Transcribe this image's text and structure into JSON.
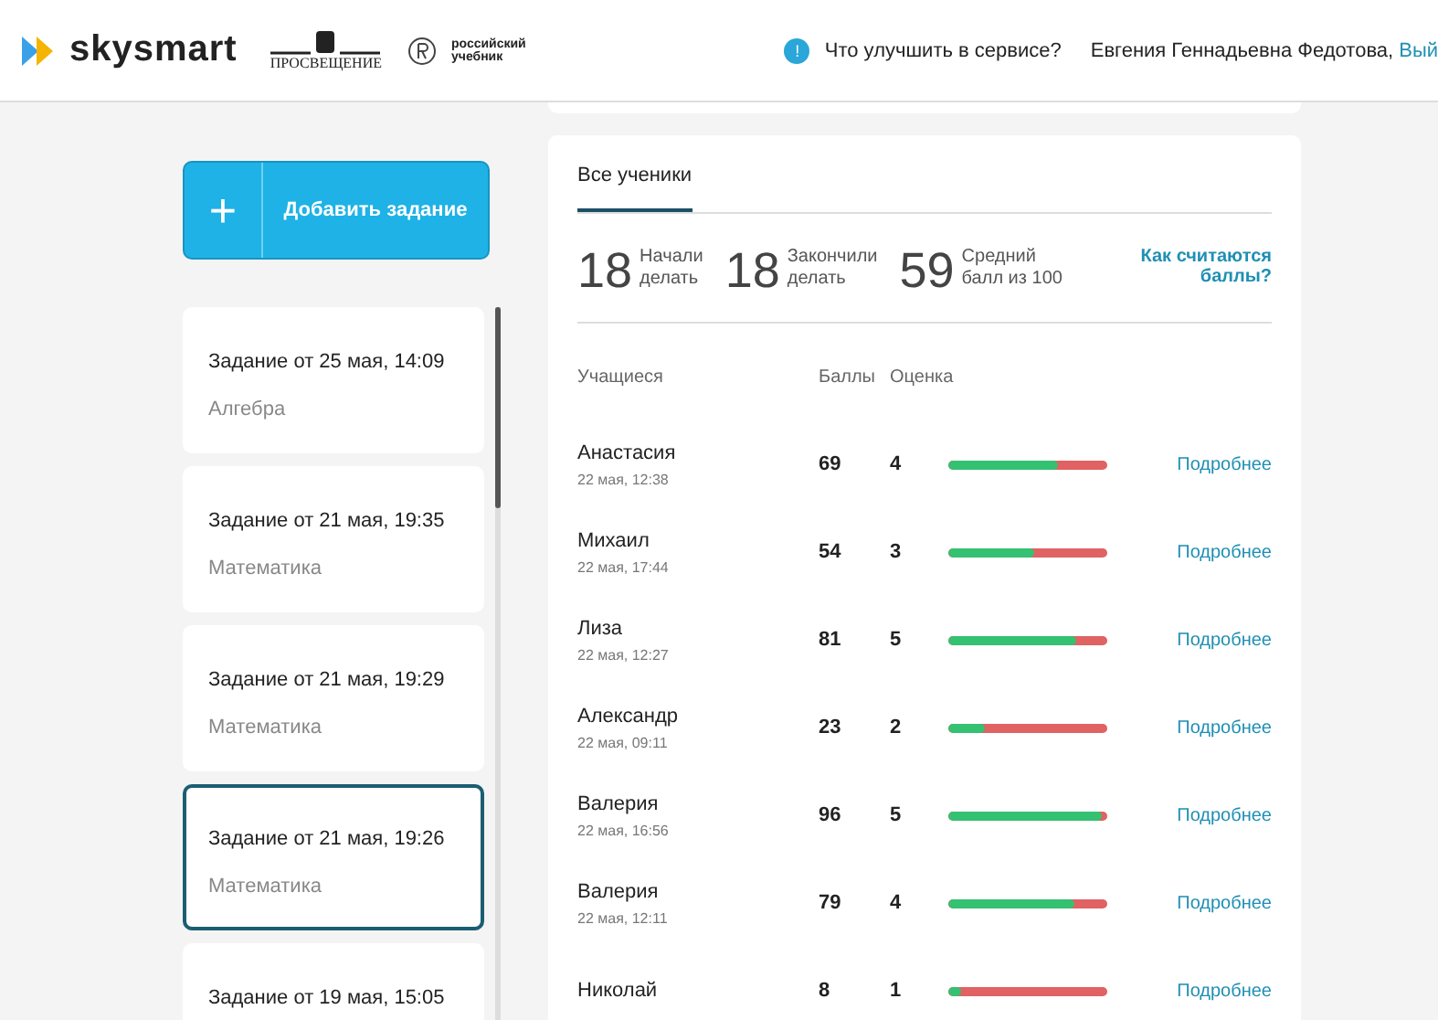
{
  "header": {
    "brand": "skysmart",
    "partner_1": "ПРОСВЕЩЕНИЕ",
    "partner_2": "российский учебник",
    "help_badge": "!",
    "help_link": "Что улучшить в сервисе?",
    "user_name": "Евгения Геннадьевна Федотова,",
    "logout_link": "Вый"
  },
  "sidebar": {
    "add_button": {
      "icon": "+",
      "label": "Добавить задание"
    },
    "assignments": [
      {
        "title": "Задание от 25 мая, 14:09",
        "subject": "Алгебра",
        "selected": false
      },
      {
        "title": "Задание от 21 мая, 19:35",
        "subject": "Математика",
        "selected": false
      },
      {
        "title": "Задание от 21 мая, 19:29",
        "subject": "Математика",
        "selected": false
      },
      {
        "title": "Задание от 21 мая, 19:26",
        "subject": "Математика",
        "selected": true
      },
      {
        "title": "Задание от 19 мая, 15:05",
        "selected": false
      }
    ]
  },
  "main": {
    "tabs": [
      {
        "label": "Все ученики",
        "selected": true
      }
    ],
    "stats": [
      {
        "number": "18",
        "label_1": "Начали",
        "label_2": "делать"
      },
      {
        "number": "18",
        "label_1": "Закончили",
        "label_2": "делать"
      },
      {
        "number": "59",
        "label_1": "Средний",
        "label_2": "балл из 100"
      }
    ],
    "help_link": "Как считаются баллы?",
    "columns": [
      "Учащиеся",
      "Баллы",
      "Оценка"
    ],
    "rows": [
      {
        "name": "Анастасия",
        "time": "22 мая, 12:38",
        "score": "69",
        "grade": "4",
        "level": 0.69,
        "link": "Подробнее"
      },
      {
        "name": "Михаил",
        "time": "22 мая, 17:44",
        "score": "54",
        "grade": "3",
        "level": 0.54,
        "link": "Подробнее"
      },
      {
        "name": "Лиза",
        "time": "22 мая, 12:27",
        "score": "81",
        "grade": "5",
        "level": 0.81,
        "link": "Подробнее"
      },
      {
        "name": "Александр",
        "time": "22 мая, 09:11",
        "score": "23",
        "grade": "2",
        "level": 0.23,
        "link": "Подробнее"
      },
      {
        "name": "Валерия",
        "time": "22 мая, 16:56",
        "score": "96",
        "grade": "5",
        "level": 0.96,
        "link": "Подробнее"
      },
      {
        "name": "Валерия",
        "time": "22 мая, 12:11",
        "score": "79",
        "grade": "4",
        "level": 0.79,
        "link": "Подробнее"
      },
      {
        "name": "Николай",
        "score": "8",
        "grade": "1",
        "level": 0.08,
        "link": "Подробнее"
      }
    ]
  }
}
